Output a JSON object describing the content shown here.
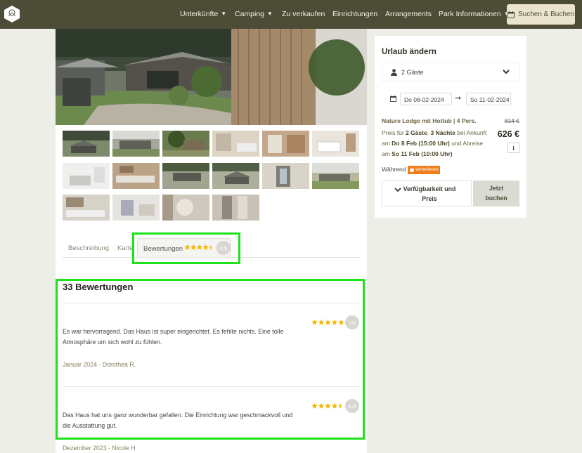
{
  "nav": {
    "items": [
      {
        "label": "Unterkünfte",
        "dropdown": true
      },
      {
        "label": "Camping",
        "dropdown": true
      },
      {
        "label": "Zu verkaufen",
        "dropdown": false
      },
      {
        "label": "Einrichtungen",
        "dropdown": false
      },
      {
        "label": "Arrangements",
        "dropdown": false
      },
      {
        "label": "Park Informationen",
        "dropdown": true
      }
    ],
    "book_label": "Suchen & Buchen"
  },
  "tabs": {
    "description": "Beschreibung",
    "map": "Karte",
    "reviews": "Bewertungen",
    "reviews_score": "8,5",
    "reviews_stars": 4.5
  },
  "reviews": {
    "heading": "33 Bewertungen",
    "items": [
      {
        "text": "Es war hervorragend. Das Haus ist super eingerichtet. Es fehlte nichts. Eine tolle Atmosphäre um sich wohl zu fühlen.",
        "date": "Januar 2024 - Dorothea R.",
        "score": "10",
        "stars": 5
      },
      {
        "text": "Das Haus hat uns ganz wunderbar gefallen. Die Einrichtung war geschmackvoll und die Ausstattung gut.",
        "date": "Dezember 2023 - Nicole H.",
        "score": "8,8",
        "stars": 4.5
      }
    ]
  },
  "booking": {
    "title": "Urlaub ändern",
    "guests": "2 Gäste",
    "date_from": "Do 08-02-2024",
    "date_to": "So 11-02-2024",
    "product": "Nature Lodge mit Hottub | 4 Pers.",
    "old_price": "814 €",
    "price": "626 €",
    "price_desc": {
      "p1": "Preis für ",
      "guests": "2 Gäste",
      "p2": ", ",
      "nights": "3 Nächte",
      "p3": " bei Ankunft am ",
      "arrival": "Do 8 Feb (15:00 Uhr)",
      "p4": " und Abreise am ",
      "departure": "So 11 Feb (10:00 Uhr)"
    },
    "info": "i",
    "while_label": "Während",
    "badge": "Winterferien",
    "availability": "Verfügbarkeit und Preis",
    "book_now": "Jetzt buchen"
  },
  "colors": {
    "nav_bg": "#4d4c36",
    "accent": "#ef7d1a",
    "star": "#f2b705",
    "highlight": "#1ee11e"
  }
}
